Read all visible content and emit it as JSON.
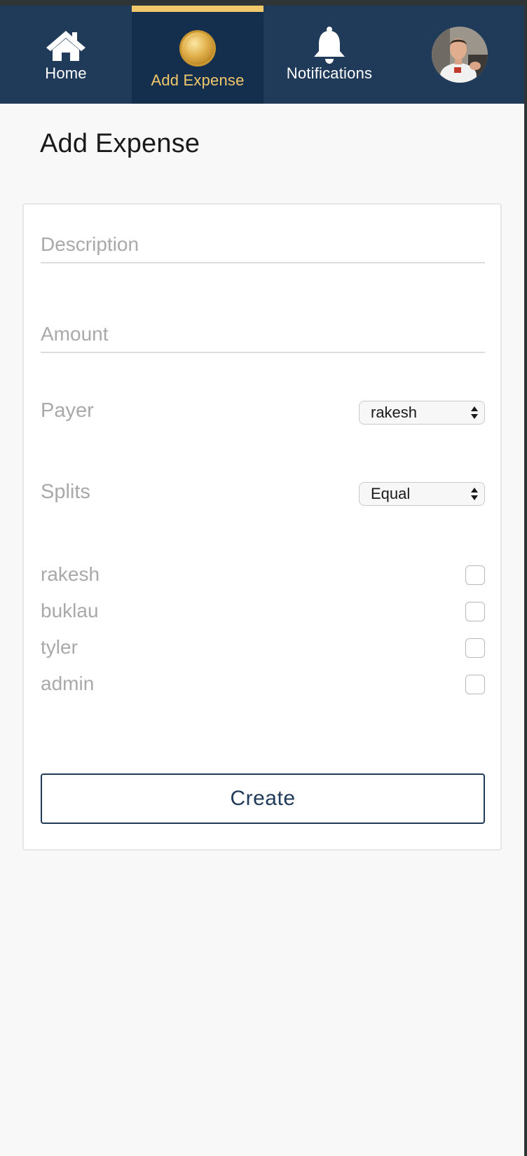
{
  "nav": {
    "home_label": "Home",
    "home_icon": "home-icon",
    "add_expense_label": "Add Expense",
    "add_expense_icon": "coin-icon",
    "notifications_label": "Notifications",
    "notifications_icon": "bell-icon",
    "avatar_icon": "user-avatar",
    "active_item": "Add Expense"
  },
  "page": {
    "title": "Add Expense"
  },
  "form": {
    "description": {
      "placeholder": "Description",
      "value": ""
    },
    "amount": {
      "placeholder": "Amount",
      "value": ""
    },
    "payer": {
      "label": "Payer",
      "selected": "rakesh"
    },
    "splits": {
      "label": "Splits",
      "selected": "Equal"
    },
    "members": [
      {
        "name": "rakesh",
        "checked": false
      },
      {
        "name": "buklau",
        "checked": false
      },
      {
        "name": "tyler",
        "checked": false
      },
      {
        "name": "admin",
        "checked": false
      }
    ],
    "create_label": "Create"
  },
  "colors": {
    "nav_bg": "#203a5a",
    "nav_active_bg": "#142e4e",
    "accent": "#f1c96a",
    "button_border": "#203a5a"
  }
}
